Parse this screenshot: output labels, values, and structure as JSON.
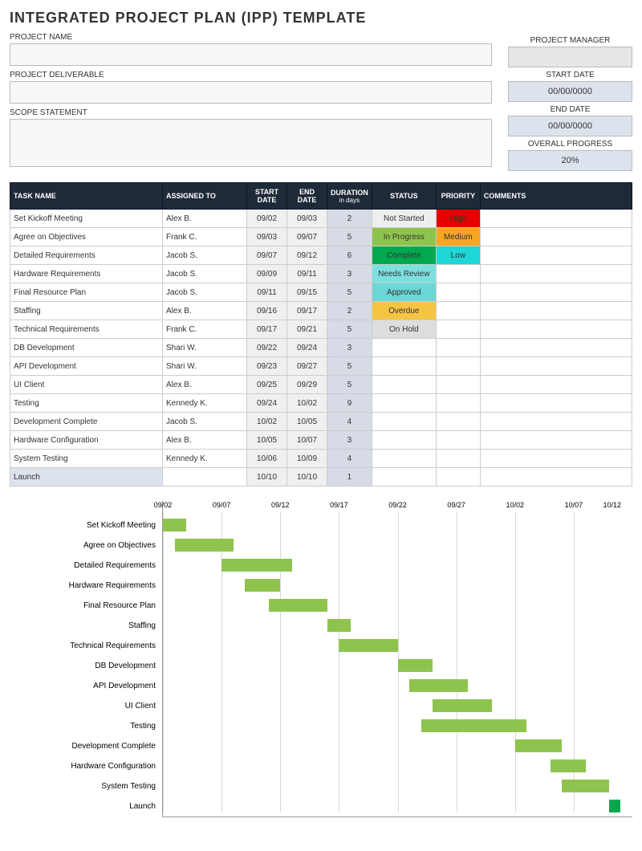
{
  "title": "INTEGRATED PROJECT PLAN (IPP) TEMPLATE",
  "labels": {
    "project_name": "PROJECT NAME",
    "project_deliverable": "PROJECT DELIVERABLE",
    "scope_statement": "SCOPE STATEMENT",
    "project_manager": "PROJECT MANAGER",
    "start_date": "START DATE",
    "end_date": "END DATE",
    "overall_progress": "OVERALL PROGRESS"
  },
  "meta": {
    "project_name": "",
    "project_deliverable": "",
    "scope_statement": "",
    "project_manager": "",
    "start_date": "00/00/0000",
    "end_date": "00/00/0000",
    "overall_progress": "20%"
  },
  "columns": {
    "task_name": "TASK NAME",
    "assigned_to": "ASSIGNED TO",
    "start_date": "START DATE",
    "end_date": "END DATE",
    "duration": "DURATION",
    "duration_sub": "in days",
    "status": "STATUS",
    "priority": "PRIORITY",
    "comments": "COMMENTS"
  },
  "tasks": [
    {
      "name": "Set Kickoff Meeting",
      "assigned": "Alex B.",
      "start": "09/02",
      "end": "09/03",
      "duration": "2",
      "status": "Not Started",
      "status_key": "not-started",
      "priority": "High",
      "priority_key": "high",
      "comments": ""
    },
    {
      "name": "Agree on Objectives",
      "assigned": "Frank C.",
      "start": "09/03",
      "end": "09/07",
      "duration": "5",
      "status": "In Progress",
      "status_key": "in-progress",
      "priority": "Medium",
      "priority_key": "medium",
      "comments": ""
    },
    {
      "name": "Detailed Requirements",
      "assigned": "Jacob S.",
      "start": "09/07",
      "end": "09/12",
      "duration": "6",
      "status": "Complete",
      "status_key": "complete",
      "priority": "Low",
      "priority_key": "low",
      "comments": ""
    },
    {
      "name": "Hardware Requirements",
      "assigned": "Jacob S.",
      "start": "09/09",
      "end": "09/11",
      "duration": "3",
      "status": "Needs Review",
      "status_key": "needs-review",
      "priority": "",
      "priority_key": "",
      "comments": ""
    },
    {
      "name": "Final Resource Plan",
      "assigned": "Jacob S.",
      "start": "09/11",
      "end": "09/15",
      "duration": "5",
      "status": "Approved",
      "status_key": "approved",
      "priority": "",
      "priority_key": "",
      "comments": ""
    },
    {
      "name": "Staffing",
      "assigned": "Alex B.",
      "start": "09/16",
      "end": "09/17",
      "duration": "2",
      "status": "Overdue",
      "status_key": "overdue",
      "priority": "",
      "priority_key": "",
      "comments": ""
    },
    {
      "name": "Technical Requirements",
      "assigned": "Frank C.",
      "start": "09/17",
      "end": "09/21",
      "duration": "5",
      "status": "On Hold",
      "status_key": "on-hold",
      "priority": "",
      "priority_key": "",
      "comments": ""
    },
    {
      "name": "DB Development",
      "assigned": "Shari W.",
      "start": "09/22",
      "end": "09/24",
      "duration": "3",
      "status": "",
      "status_key": "",
      "priority": "",
      "priority_key": "",
      "comments": ""
    },
    {
      "name": "API Development",
      "assigned": "Shari W.",
      "start": "09/23",
      "end": "09/27",
      "duration": "5",
      "status": "",
      "status_key": "",
      "priority": "",
      "priority_key": "",
      "comments": ""
    },
    {
      "name": "UI Client",
      "assigned": "Alex B.",
      "start": "09/25",
      "end": "09/29",
      "duration": "5",
      "status": "",
      "status_key": "",
      "priority": "",
      "priority_key": "",
      "comments": ""
    },
    {
      "name": "Testing",
      "assigned": "Kennedy K.",
      "start": "09/24",
      "end": "10/02",
      "duration": "9",
      "status": "",
      "status_key": "",
      "priority": "",
      "priority_key": "",
      "comments": ""
    },
    {
      "name": "Development Complete",
      "assigned": "Jacob S.",
      "start": "10/02",
      "end": "10/05",
      "duration": "4",
      "status": "",
      "status_key": "",
      "priority": "",
      "priority_key": "",
      "comments": ""
    },
    {
      "name": "Hardware Configuration",
      "assigned": "Alex B.",
      "start": "10/05",
      "end": "10/07",
      "duration": "3",
      "status": "",
      "status_key": "",
      "priority": "",
      "priority_key": "",
      "comments": ""
    },
    {
      "name": "System Testing",
      "assigned": "Kennedy K.",
      "start": "10/06",
      "end": "10/09",
      "duration": "4",
      "status": "",
      "status_key": "",
      "priority": "",
      "priority_key": "",
      "comments": ""
    },
    {
      "name": "Launch",
      "assigned": "",
      "start": "10/10",
      "end": "10/10",
      "duration": "1",
      "status": "",
      "status_key": "",
      "priority": "",
      "priority_key": "",
      "comments": "",
      "highlight": true
    }
  ],
  "chart_data": {
    "type": "gantt",
    "x_start": "09/02",
    "x_end": "10/12",
    "ticks": [
      "09/02",
      "09/07",
      "09/12",
      "09/17",
      "09/22",
      "09/27",
      "10/02",
      "10/07",
      "10/12"
    ],
    "series": [
      {
        "name": "Set Kickoff Meeting",
        "start": "09/02",
        "end": "09/03",
        "start_offset_days": 0,
        "duration_days": 2
      },
      {
        "name": "Agree on Objectives",
        "start": "09/03",
        "end": "09/07",
        "start_offset_days": 1,
        "duration_days": 5
      },
      {
        "name": "Detailed Requirements",
        "start": "09/07",
        "end": "09/12",
        "start_offset_days": 5,
        "duration_days": 6
      },
      {
        "name": "Hardware Requirements",
        "start": "09/09",
        "end": "09/11",
        "start_offset_days": 7,
        "duration_days": 3
      },
      {
        "name": "Final Resource Plan",
        "start": "09/11",
        "end": "09/15",
        "start_offset_days": 9,
        "duration_days": 5
      },
      {
        "name": "Staffing",
        "start": "09/16",
        "end": "09/17",
        "start_offset_days": 14,
        "duration_days": 2
      },
      {
        "name": "Technical Requirements",
        "start": "09/17",
        "end": "09/21",
        "start_offset_days": 15,
        "duration_days": 5
      },
      {
        "name": "DB Development",
        "start": "09/22",
        "end": "09/24",
        "start_offset_days": 20,
        "duration_days": 3
      },
      {
        "name": "API Development",
        "start": "09/23",
        "end": "09/27",
        "start_offset_days": 21,
        "duration_days": 5
      },
      {
        "name": "UI Client",
        "start": "09/25",
        "end": "09/29",
        "start_offset_days": 23,
        "duration_days": 5
      },
      {
        "name": "Testing",
        "start": "09/24",
        "end": "10/02",
        "start_offset_days": 22,
        "duration_days": 9
      },
      {
        "name": "Development Complete",
        "start": "10/02",
        "end": "10/05",
        "start_offset_days": 30,
        "duration_days": 4
      },
      {
        "name": "Hardware Configuration",
        "start": "10/05",
        "end": "10/07",
        "start_offset_days": 33,
        "duration_days": 3
      },
      {
        "name": "System Testing",
        "start": "10/06",
        "end": "10/09",
        "start_offset_days": 34,
        "duration_days": 4
      },
      {
        "name": "Launch",
        "start": "10/10",
        "end": "10/10",
        "start_offset_days": 38,
        "duration_days": 1,
        "color": "launch"
      }
    ],
    "total_days": 40
  }
}
